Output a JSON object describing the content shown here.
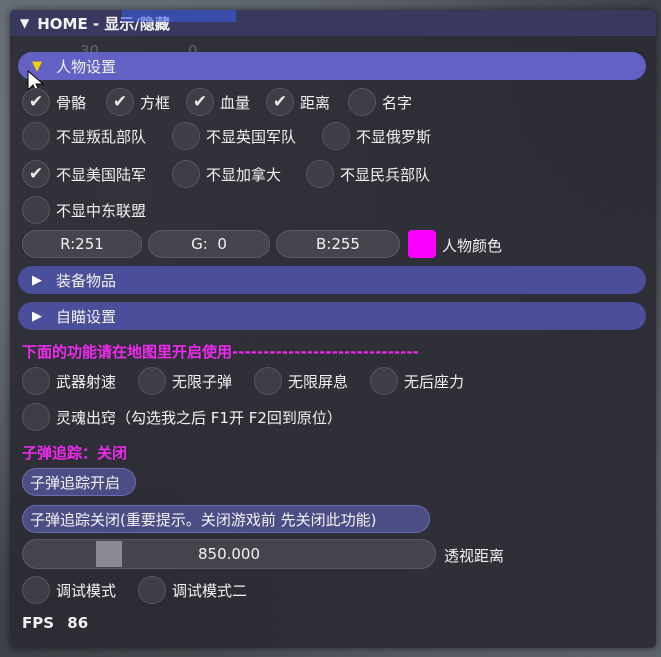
{
  "window": {
    "title": "HOME - 显示/隐藏"
  },
  "ghost": {
    "left_value": "30",
    "right_value": "0"
  },
  "sections": {
    "character": "人物设置",
    "equipment": "装备物品",
    "aimbot": "自瞄设置"
  },
  "character_checks": [
    {
      "label": "骨骼",
      "checked": true
    },
    {
      "label": "方框",
      "checked": true
    },
    {
      "label": "血量",
      "checked": true
    },
    {
      "label": "距离",
      "checked": true
    },
    {
      "label": "名字",
      "checked": false
    },
    {
      "label": "不显叛乱部队",
      "checked": false
    },
    {
      "label": "不显英国军队",
      "checked": false
    },
    {
      "label": "不显俄罗斯",
      "checked": false
    },
    {
      "label": "不显美国陆军",
      "checked": true
    },
    {
      "label": "不显加拿大",
      "checked": false
    },
    {
      "label": "不显民兵部队",
      "checked": false
    },
    {
      "label": "不显中东联盟",
      "checked": false
    }
  ],
  "color": {
    "r_label": "R:251",
    "g_label": "G:  0",
    "b_label": "B:255",
    "swatch": "#fb00ff",
    "label": "人物颜色"
  },
  "notice": "下面的功能请在地图里开启使用------------------------------",
  "feature_checks": [
    {
      "label": "武器射速",
      "checked": false
    },
    {
      "label": "无限子弹",
      "checked": false
    },
    {
      "label": "无限屏息",
      "checked": false
    },
    {
      "label": "无后座力",
      "checked": false
    },
    {
      "label": "灵魂出窍（勾选我之后 F1开 F2回到原位）",
      "checked": false
    }
  ],
  "bullet_tracking": {
    "status": "子弹追踪：关闭",
    "on_button": "子弹追踪开启",
    "off_button": "子弹追踪关闭(重要提示。关闭游戏前 先关闭此功能)"
  },
  "distance": {
    "value_text": "850.000",
    "label": "透视距离",
    "fraction": 0.19
  },
  "debug_checks": [
    {
      "label": "调试模式",
      "checked": false
    },
    {
      "label": "调试模式二",
      "checked": false
    }
  ],
  "fps": {
    "label": "FPS",
    "value": "86"
  },
  "colors": {
    "accent": "#6461c4",
    "header": "#4b4e9a",
    "magenta": "#ee2aee",
    "arrow_open": "#f5d000"
  }
}
